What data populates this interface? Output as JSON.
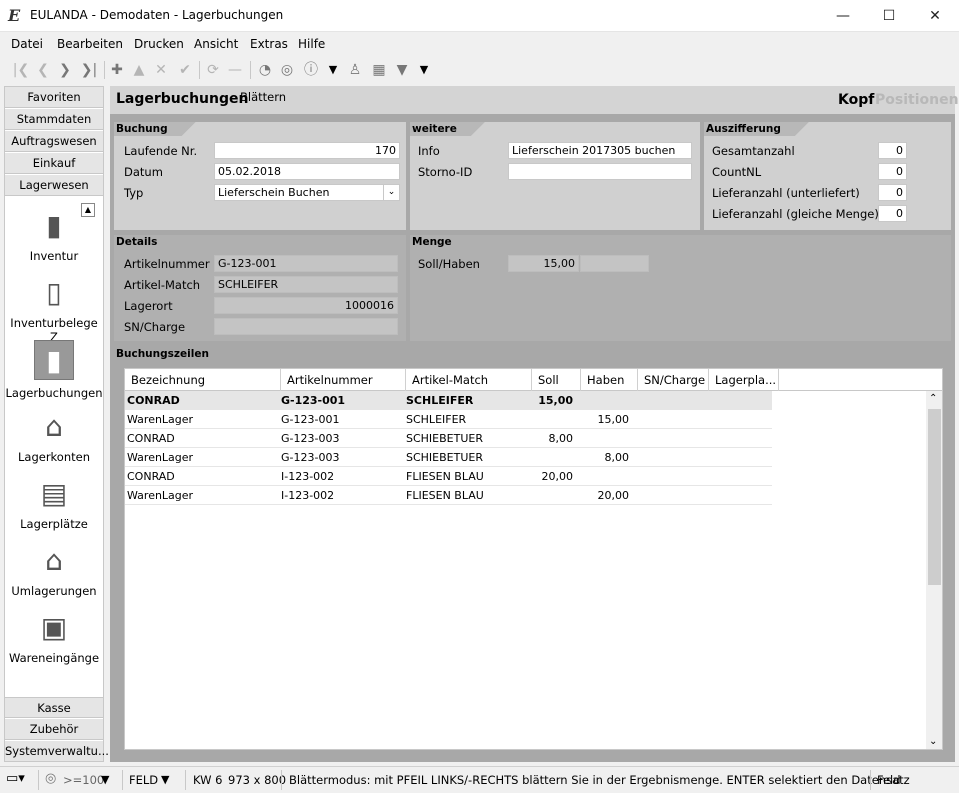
{
  "window": {
    "title": "EULANDA - Demodaten - Lagerbuchungen",
    "logo_text": "E"
  },
  "menu": [
    "Datei",
    "Bearbeiten",
    "Drucken",
    "Ansicht",
    "Extras",
    "Hilfe"
  ],
  "nav": {
    "top_buttons": [
      "Favoriten",
      "Stammdaten",
      "Auftragswesen",
      "Einkauf",
      "Lagerwesen"
    ],
    "items": [
      {
        "label": "Inventur",
        "icon": "clipboard-icon"
      },
      {
        "label": "Inventurbelege Z",
        "icon": "document-icon"
      },
      {
        "label": "Lagerbuchungen",
        "icon": "book-icon"
      },
      {
        "label": "Lagerkonten",
        "icon": "warehouse-icon"
      },
      {
        "label": "Lagerplätze",
        "icon": "shelf-icon"
      },
      {
        "label": "Umlagerungen",
        "icon": "transfer-icon"
      },
      {
        "label": "Wareneingänge",
        "icon": "truck-icon"
      }
    ],
    "bottom_buttons": [
      "Kasse",
      "Zubehör",
      "Systemverwaltu..."
    ]
  },
  "header": {
    "title": "Lagerbuchungen",
    "mode": "Blättern",
    "tab_kopf": "Kopf",
    "tab_positionen": "Positionen"
  },
  "buchung": {
    "title": "Buchung",
    "laufende_label": "Laufende Nr.",
    "laufende_value": "170",
    "datum_label": "Datum",
    "datum_value": "05.02.2018",
    "typ_label": "Typ",
    "typ_value": "Lieferschein Buchen"
  },
  "weitere": {
    "title": "weitere",
    "info_label": "Info",
    "info_value": "Lieferschein 2017305 buchen",
    "storno_label": "Storno-ID",
    "storno_value": ""
  },
  "auszifferung": {
    "title": "Auszifferung",
    "fields": [
      {
        "label": "Gesamtanzahl",
        "value": "0"
      },
      {
        "label": "CountNL",
        "value": "0"
      },
      {
        "label": "Lieferanzahl (unterliefert)",
        "value": "0"
      },
      {
        "label": "Lieferanzahl (gleiche Menge)",
        "value": "0"
      }
    ]
  },
  "details": {
    "title": "Details",
    "artikelnummer_label": "Artikelnummer",
    "artikelnummer_value": "G-123-001",
    "match_label": "Artikel-Match",
    "match_value": "SCHLEIFER",
    "lagerort_label": "Lagerort",
    "lagerort_value": "1000016",
    "sn_label": "SN/Charge",
    "sn_value": ""
  },
  "menge": {
    "title": "Menge",
    "label": "Soll/Haben",
    "soll": "15,00",
    "haben": ""
  },
  "zeilen": {
    "title": "Buchungszeilen",
    "columns": [
      "Bezeichnung",
      "Artikelnummer",
      "Artikel-Match",
      "Soll",
      "Haben",
      "SN/Charge",
      "Lagerpla..."
    ],
    "rows": [
      {
        "bez": "CONRAD",
        "nr": "G-123-001",
        "match": "SCHLEIFER",
        "soll": "15,00",
        "haben": ""
      },
      {
        "bez": "WarenLager",
        "nr": "G-123-001",
        "match": "SCHLEIFER",
        "soll": "",
        "haben": "15,00"
      },
      {
        "bez": "CONRAD",
        "nr": "G-123-003",
        "match": "SCHIEBETUER",
        "soll": "8,00",
        "haben": ""
      },
      {
        "bez": "WarenLager",
        "nr": "G-123-003",
        "match": "SCHIEBETUER",
        "soll": "",
        "haben": "8,00"
      },
      {
        "bez": "CONRAD",
        "nr": "I-123-002",
        "match": "FLIESEN BLAU",
        "soll": "20,00",
        "haben": ""
      },
      {
        "bez": "WarenLager",
        "nr": "I-123-002",
        "match": "FLIESEN BLAU",
        "soll": "",
        "haben": "20,00"
      }
    ]
  },
  "status": {
    "zoom": ">=100",
    "feld": "FELD",
    "kw": "KW 6",
    "res": "973 x 800",
    "message": "Blättermodus: mit PFEIL LINKS/-RECHTS blättern Sie in der Ergebnismenge. ENTER selektiert den Datensatz",
    "mode": "Feld"
  }
}
